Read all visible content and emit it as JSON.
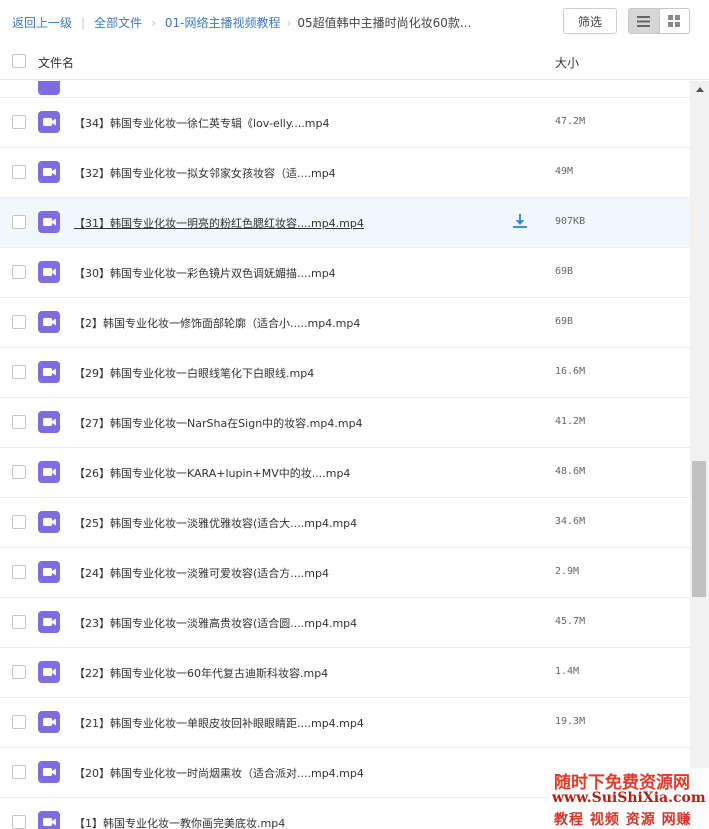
{
  "breadcrumb": {
    "back": "返回上一级",
    "all_files": "全部文件",
    "folder1": "01-网络主播视频教程",
    "current": "05超值韩中主播时尚化妆60款..."
  },
  "toolbar": {
    "filter_label": "筛选",
    "view_mode": "list"
  },
  "header": {
    "name_col": "文件名",
    "size_col": "大小"
  },
  "colors": {
    "link": "#3b7ac4",
    "video_icon": "#7f6ce0",
    "download_icon": "#3b8ed8",
    "hover_row": "#f2f7fc"
  },
  "files": [
    {
      "name": "【34】韩国专业化妆一徐仁英专辑《lov-elly....mp4",
      "size": "47.2M"
    },
    {
      "name": "【32】韩国专业化妆一拟女邻家女孩妆容（适....mp4",
      "size": "49M"
    },
    {
      "name": "【31】韩国专业化妆一明亮的粉红色腮红妆容....mp4.mp4",
      "size": "907KB"
    },
    {
      "name": "【30】韩国专业化妆一彩色镜片双色调妩媚描....mp4",
      "size": "69B"
    },
    {
      "name": "【2】韩国专业化妆一修饰面部轮廓（适合小.....mp4.mp4",
      "size": "69B"
    },
    {
      "name": "【29】韩国专业化妆一白眼线笔化下白眼线.mp4",
      "size": "16.6M"
    },
    {
      "name": "【27】韩国专业化妆一NarSha在Sign中的妆容.mp4.mp4",
      "size": "41.2M"
    },
    {
      "name": "【26】韩国专业化妆一KARA+lupin+MV中的妆....mp4",
      "size": "48.6M"
    },
    {
      "name": "【25】韩国专业化妆一淡雅优雅妆容(适合大....mp4.mp4",
      "size": "34.6M"
    },
    {
      "name": "【24】韩国专业化妆一淡雅可爱妆容(适合方....mp4",
      "size": "2.9M"
    },
    {
      "name": "【23】韩国专业化妆一淡雅高贵妆容(适合圆....mp4.mp4",
      "size": "45.7M"
    },
    {
      "name": "【22】韩国专业化妆一60年代复古迪斯科妆容.mp4",
      "size": "1.4M"
    },
    {
      "name": "【21】韩国专业化妆一单眼皮妆回补眼眼睛距....mp4.mp4",
      "size": "19.3M"
    },
    {
      "name": "【20】韩国专业化妆一时尚烟熏妆（适合派对....mp4.mp4",
      "size": ""
    },
    {
      "name": "【1】韩国专业化妆一教你画完美底妆.mp4",
      "size": ""
    }
  ],
  "hovered_row_index": 2,
  "watermark": {
    "line1": "随时下免费资源网",
    "line2": "www.SuiShiXia.com",
    "line3": "教程 视频 资源 网赚"
  }
}
